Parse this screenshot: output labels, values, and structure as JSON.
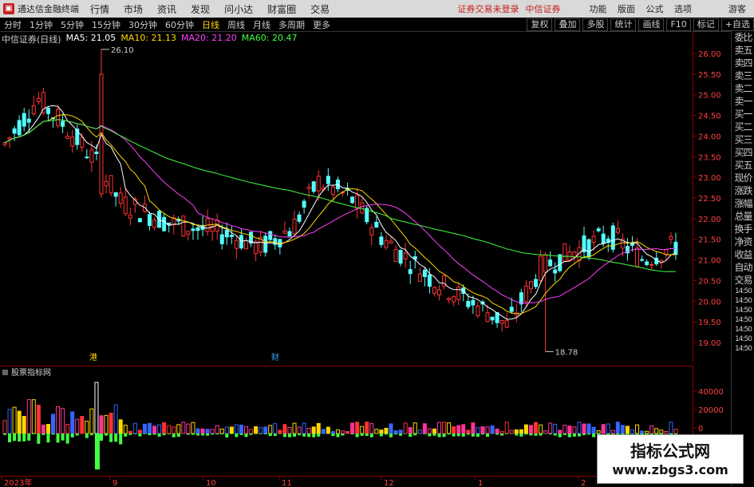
{
  "app": {
    "name": "通达信金融终端",
    "logo_glyph": "▣"
  },
  "menu": [
    "行情",
    "市场",
    "资讯",
    "发现",
    "问小达",
    "财富圈",
    "交易"
  ],
  "status": {
    "login_warning": "证券交易未登录",
    "broker": "中信证券",
    "guest": "游客"
  },
  "right_menu": [
    "功能",
    "版面",
    "公式",
    "选项"
  ],
  "periods": [
    {
      "label": "分时",
      "active": false
    },
    {
      "label": "1分钟",
      "active": false
    },
    {
      "label": "5分钟",
      "active": false
    },
    {
      "label": "15分钟",
      "active": false
    },
    {
      "label": "30分钟",
      "active": false
    },
    {
      "label": "60分钟",
      "active": false
    },
    {
      "label": "日线",
      "active": true
    },
    {
      "label": "周线",
      "active": false
    },
    {
      "label": "月线",
      "active": false
    },
    {
      "label": "多周期",
      "active": false
    },
    {
      "label": "更多",
      "active": false
    }
  ],
  "tools": [
    "复权",
    "叠加",
    "多股",
    "统计",
    "画线",
    "F10",
    "标记",
    "+自选"
  ],
  "stock_title": "中信证券(日线)",
  "ma": [
    {
      "label": "MA5: 21.05",
      "color": "#ffffff"
    },
    {
      "label": "MA10: 21.13",
      "color": "#ffd700"
    },
    {
      "label": "MA20: 21.20",
      "color": "#ff40ff"
    },
    {
      "label": "MA60: 20.47",
      "color": "#40ff40"
    }
  ],
  "price_axis": [
    "26.00",
    "25.50",
    "25.00",
    "24.50",
    "24.00",
    "23.50",
    "23.00",
    "22.50",
    "22.00",
    "21.50",
    "21.00",
    "20.50",
    "20.00",
    "19.50",
    "19.00"
  ],
  "annotations": {
    "high": "26.10",
    "low": "18.78",
    "event1": "港",
    "event2": "财"
  },
  "sub_title": "股票指标网",
  "sub_axis": [
    "40000",
    "20000",
    "0"
  ],
  "dates": [
    "2023年",
    "9",
    "10",
    "11",
    "12",
    "1",
    "2"
  ],
  "side_panel": [
    "委比",
    "卖五",
    "卖四",
    "卖三",
    "卖二",
    "卖一",
    "买一",
    "买二",
    "买三",
    "买四",
    "买五",
    "现价",
    "涨跌",
    "涨幅",
    "总量",
    "换手",
    "净资",
    "收益",
    "自动",
    "交易",
    "14:50",
    "14:50",
    "14:50",
    "14:50",
    "14:50",
    "14:50",
    "14:50"
  ],
  "watermark": {
    "line1": "指标公式网",
    "line2": "www.zbgs3.com"
  },
  "colors": {
    "up": "#ff3333",
    "down": "#54ffff",
    "axis": "#8b0000",
    "grid": "#8b0000"
  }
}
